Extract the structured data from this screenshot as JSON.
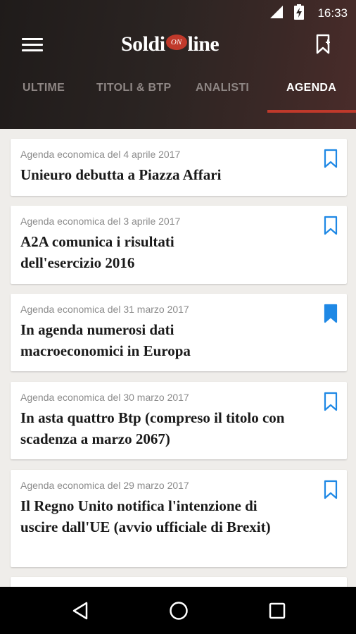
{
  "status": {
    "time": "16:33"
  },
  "app": {
    "logo_left": "Soldi",
    "logo_badge": "ON",
    "logo_right": "line"
  },
  "tabs": [
    {
      "label": "ULTIME"
    },
    {
      "label": "TITOLI & BTP"
    },
    {
      "label": "ANALISTI"
    },
    {
      "label": "AGENDA",
      "active": true
    }
  ],
  "articles": [
    {
      "meta": "Agenda economica del 4 aprile 2017",
      "title": "Unieuro debutta a Piazza Affari",
      "bookmarked": false
    },
    {
      "meta": "Agenda economica del 3 aprile 2017",
      "title": "A2A comunica i risultati dell'esercizio 2016",
      "bookmarked": false
    },
    {
      "meta": "Agenda economica del 31 marzo 2017",
      "title": "In agenda numerosi dati macroeconomici in Europa",
      "bookmarked": true
    },
    {
      "meta": "Agenda economica del 30 marzo 2017",
      "title": "In asta quattro Btp (compreso il titolo con scadenza a marzo 2067)",
      "bookmarked": false
    },
    {
      "meta": "Agenda economica del 29 marzo 2017",
      "title": "Il Regno Unito notifica l'intenzione di uscire dall'UE (avvio ufficiale di Brexit)",
      "bookmarked": false
    }
  ],
  "colors": {
    "accent": "#c0392b",
    "bookmark": "#1e88e5"
  }
}
